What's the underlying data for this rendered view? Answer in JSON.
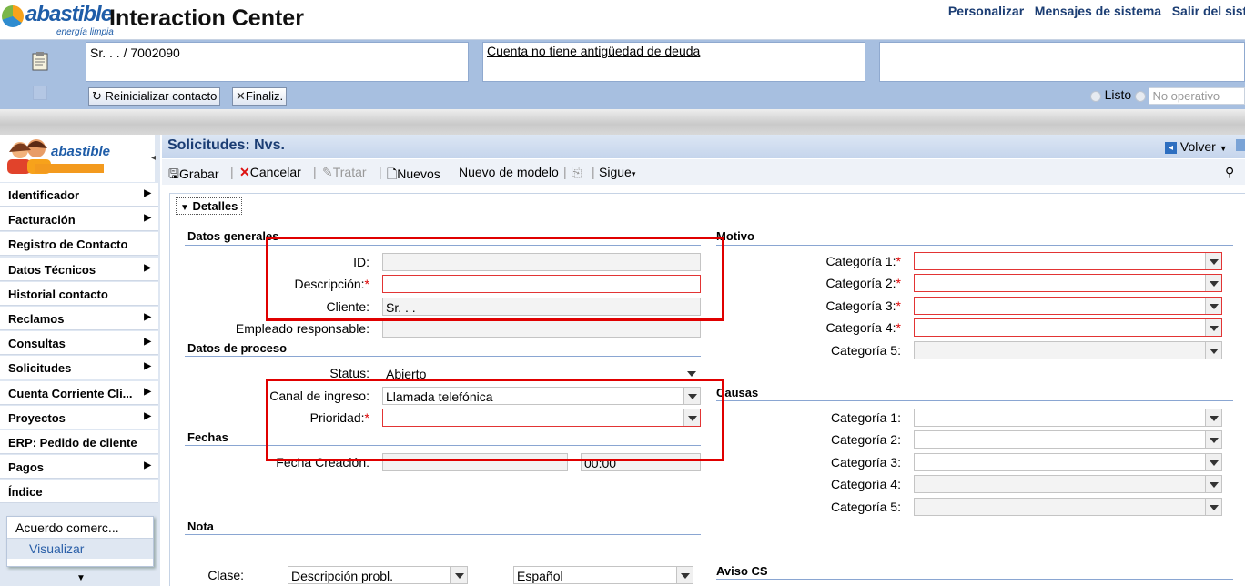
{
  "header": {
    "logo_text": "abastible",
    "logo_sub": "energía limpia",
    "app_title": "Interaction Center",
    "links": [
      "Personalizar",
      "Mensajes de sistema",
      "Salir del siste"
    ]
  },
  "context": {
    "customer": "Sr. . . / 7002090",
    "debt_note": "Cuenta no tiene antigüedad de deuda",
    "reset_button": "Reinicializar contacto",
    "end_button": "Finaliz.",
    "status_ready": "Listo",
    "status_not_operative": "No operativo"
  },
  "nav": {
    "logo_brand": "abastible",
    "items": [
      {
        "label": "Identificador",
        "arrow": true
      },
      {
        "label": "Facturación",
        "arrow": true
      },
      {
        "label": "Registro de Contacto",
        "arrow": false
      },
      {
        "label": "Datos Técnicos",
        "arrow": true
      },
      {
        "label": "Historial contacto",
        "arrow": false
      },
      {
        "label": "Reclamos",
        "arrow": true
      },
      {
        "label": "Consultas",
        "arrow": true
      },
      {
        "label": "Solicitudes",
        "arrow": true
      },
      {
        "label": "Cuenta Corriente Cli...",
        "arrow": true
      },
      {
        "label": "Proyectos",
        "arrow": true
      },
      {
        "label": "ERP: Pedido de cliente",
        "arrow": false
      },
      {
        "label": "Pagos",
        "arrow": true
      },
      {
        "label": "Índice",
        "arrow": false
      }
    ],
    "card_title": "Acuerdo comerc...",
    "card_link": "Visualizar"
  },
  "main": {
    "title": "Solicitudes: Nvs.",
    "back": "Volver",
    "toolbar": {
      "save": "Grabar",
      "cancel": "Cancelar",
      "process": "Tratar",
      "new": "Nuevos",
      "new_template": "Nuevo de modelo",
      "next": "Sigue"
    },
    "details": "Detalles",
    "datos_generales": {
      "heading": "Datos generales",
      "id_label": "ID:",
      "id_value": "",
      "desc_label": "Descripción:",
      "desc_value": "",
      "client_label": "Cliente:",
      "client_value": "Sr. . .",
      "employee_label": "Empleado responsable:",
      "employee_value": ""
    },
    "datos_proceso": {
      "heading": "Datos de proceso",
      "status_label": "Status:",
      "status_value": "Abierto",
      "channel_label": "Canal de ingreso:",
      "channel_value": "Llamada telefónica",
      "priority_label": "Prioridad:",
      "priority_value": ""
    },
    "fechas": {
      "heading": "Fechas",
      "created_label": "Fecha Creación:",
      "date_value": "",
      "time_value": "00:00"
    },
    "nota": {
      "heading": "Nota",
      "class_label": "Clase:",
      "class_value": "Descripción probl.",
      "lang_value": "Español"
    },
    "motivo": {
      "heading": "Motivo",
      "cats": [
        "Categoría 1:",
        "Categoría 2:",
        "Categoría 3:",
        "Categoría 4:",
        "Categoría 5:"
      ]
    },
    "causas": {
      "heading": "Causas",
      "cats": [
        "Categoría 1:",
        "Categoría 2:",
        "Categoría 3:",
        "Categoría 4:",
        "Categoría 5:"
      ]
    },
    "aviso": {
      "heading": "Aviso CS"
    }
  },
  "colors": {
    "accent": "#1b3d73",
    "required": "#dd0000",
    "highlight": "#e00000",
    "context_band": "#a7bfe0"
  }
}
